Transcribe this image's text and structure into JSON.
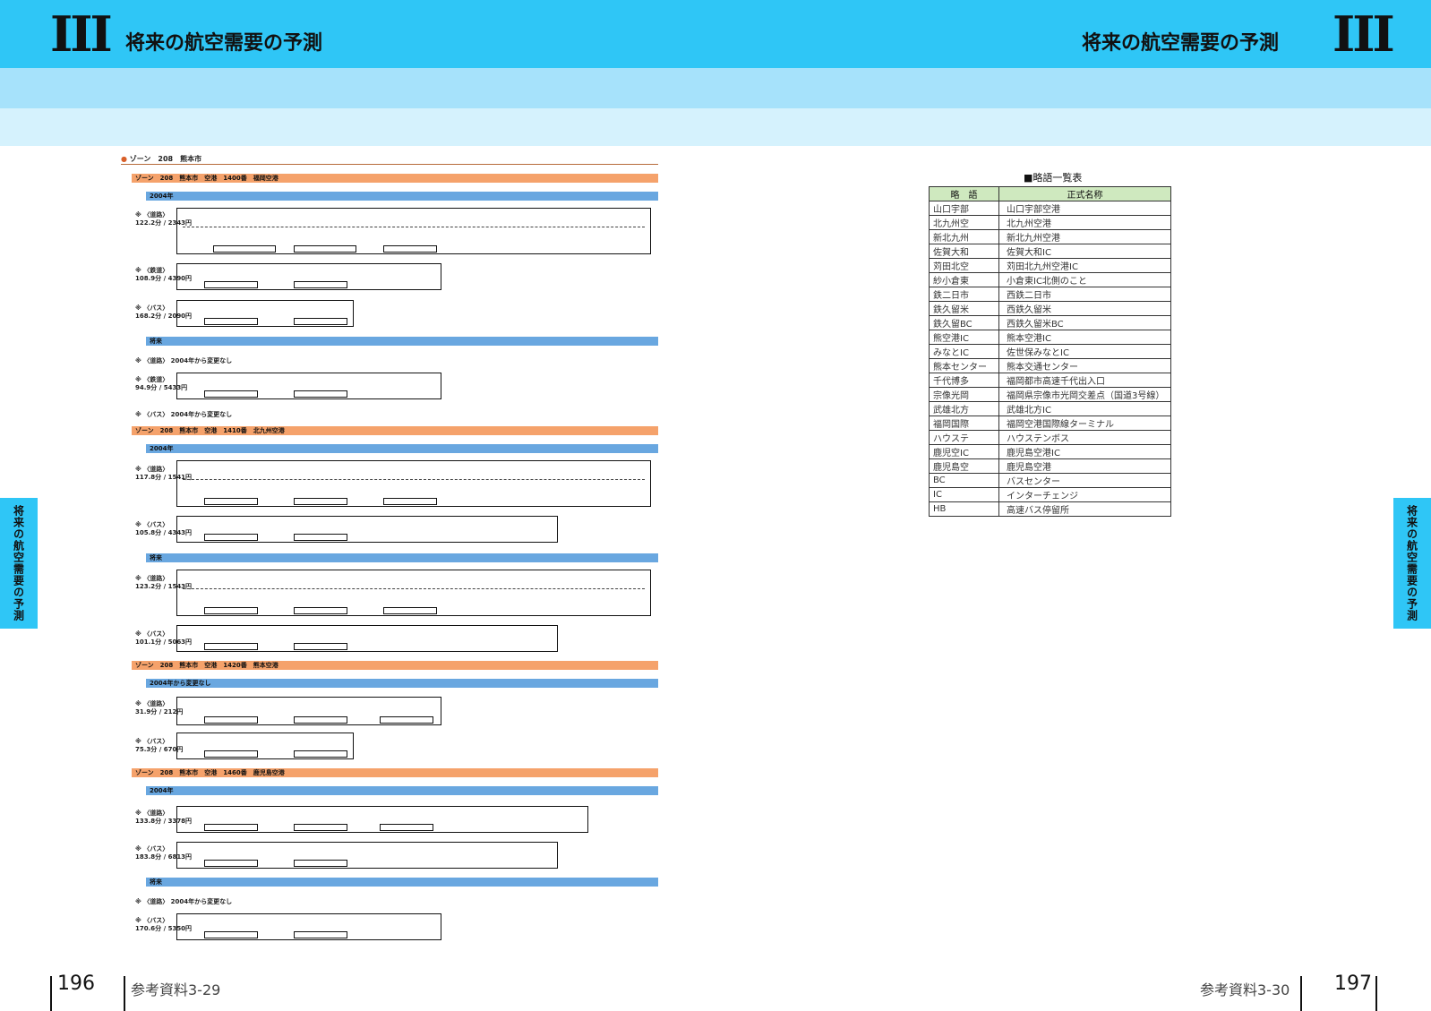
{
  "header": {
    "left_numeral": "III",
    "left_title": "将来の航空需要の予測",
    "right_title": "将来の航空需要の予測",
    "right_numeral": "III"
  },
  "side_tab": {
    "text": "将来の航空需要の予測"
  },
  "footer": {
    "left_page": "196",
    "left_ref": "参考資料3-29",
    "right_ref": "参考資料3-30",
    "right_page": "197"
  },
  "left_page": {
    "top_heading": "ゾーン　208　熊本市",
    "zones": [
      {
        "bar": "ゾーン　208　熊本市　空港　1400番　福岡空港",
        "year": "2004年"
      },
      {
        "bar": "ゾーン　208　熊本市　空港　1410番　北九州空港",
        "year": "2004年"
      },
      {
        "bar": "ゾーン　208　熊本市　空港　1420番　熊本空港",
        "year": "2004年から変更なし"
      },
      {
        "bar": "ゾーン　208　熊本市　空港　1460番　鹿児島空港",
        "year": "2004年"
      }
    ],
    "notes": {
      "no_change_road": "〈道路〉 2004年から変更なし",
      "no_change_bus": "〈バス〉 2004年から変更なし"
    },
    "routes": [
      {
        "label": "※ 〈道路〉",
        "sub": "122.2分 / 2343円"
      },
      {
        "label": "※ 〈鉄道〉",
        "sub": "108.9分 / 4390円"
      },
      {
        "label": "※ 〈バス〉",
        "sub": "168.2分 / 2090円"
      },
      {
        "label": "※ 〈鉄道〉",
        "sub": "94.9分 / 5433円"
      },
      {
        "label": "※ 〈道路〉",
        "sub": "117.8分 / 1541円"
      },
      {
        "label": "※ 〈バス〉",
        "sub": "105.8分 / 4343円"
      },
      {
        "label": "※ 〈道路〉",
        "sub": "123.2分 / 1543円"
      },
      {
        "label": "※ 〈バス〉",
        "sub": "101.1分 / 5063円"
      },
      {
        "label": "※ 〈道路〉",
        "sub": "31.9分 / 212円"
      },
      {
        "label": "※ 〈バス〉",
        "sub": "75.3分 / 670円"
      },
      {
        "label": "※ 〈道路〉",
        "sub": "133.8分 / 3378円"
      },
      {
        "label": "※ 〈バス〉",
        "sub": "183.8分 / 6813円"
      },
      {
        "label": "※ 〈バス〉",
        "sub": "170.6分 / 5350円"
      }
    ],
    "future_label": "将来"
  },
  "abbr_table": {
    "caption": "■略語一覧表",
    "headers": [
      "略　語",
      "正式名称"
    ],
    "rows": [
      [
        "山口宇部",
        "山口宇部空港"
      ],
      [
        "北九州空",
        "北九州空港"
      ],
      [
        "新北九州",
        "新北九州空港"
      ],
      [
        "佐賀大和",
        "佐賀大和IC"
      ],
      [
        "苅田北空",
        "苅田北九州空港IC"
      ],
      [
        "紗小倉東",
        "小倉東IC北側のこと"
      ],
      [
        "鉄二日市",
        "西鉄二日市"
      ],
      [
        "鉄久留米",
        "西鉄久留米"
      ],
      [
        "鉄久留BC",
        "西鉄久留米BC"
      ],
      [
        "熊空港IC",
        "熊本空港IC"
      ],
      [
        "みなとIC",
        "佐世保みなとIC"
      ],
      [
        "熊本センター",
        "熊本交通センター"
      ],
      [
        "千代博多",
        "福岡都市高速千代出入口"
      ],
      [
        "宗像光岡",
        "福岡県宗像市光岡交差点（国道3号線）"
      ],
      [
        "武雄北方",
        "武雄北方IC"
      ],
      [
        "福岡国際",
        "福岡空港国際線ターミナル"
      ],
      [
        "ハウステ",
        "ハウステンボス"
      ],
      [
        "鹿児空IC",
        "鹿児島空港IC"
      ],
      [
        "鹿児島空",
        "鹿児島空港"
      ],
      [
        "BC",
        "バスセンター"
      ],
      [
        "IC",
        "インターチェンジ"
      ],
      [
        "HB",
        "高速バス停留所"
      ]
    ]
  }
}
